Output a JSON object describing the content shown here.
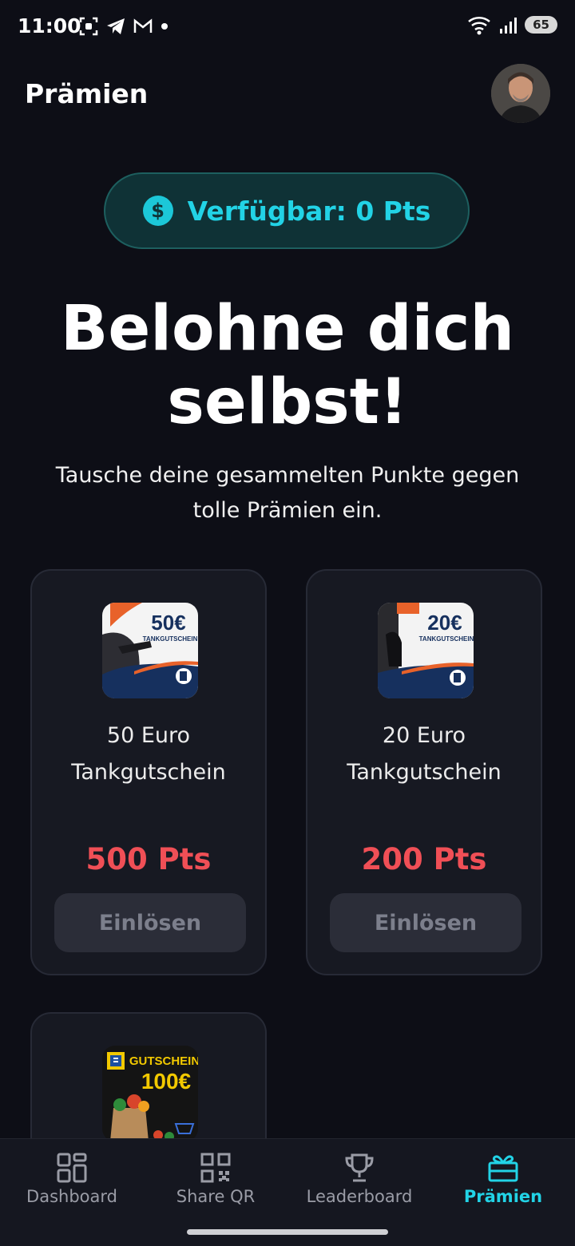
{
  "status": {
    "time": "11:00",
    "battery": "65"
  },
  "header": {
    "title": "Prämien"
  },
  "points": {
    "label": "Verfügbar: 0 Pts"
  },
  "hero": {
    "headline_line1": "Belohne dich",
    "headline_line2": "selbst!",
    "subline": "Tausche deine gesammelten Punkte gegen tolle Prämien ein."
  },
  "rewards": [
    {
      "title": "50 Euro Tankgutschein",
      "price": "500 Pts",
      "button": "Einlösen",
      "image_amount": "50€",
      "image_caption": "TANKGUTSCHEIN"
    },
    {
      "title": "20 Euro Tankgutschein",
      "price": "200 Pts",
      "button": "Einlösen",
      "image_amount": "20€",
      "image_caption": "TANKGUTSCHEIN"
    },
    {
      "image_caption": "GUTSCHEIN",
      "image_amount": "100€"
    }
  ],
  "nav": [
    {
      "label": "Dashboard",
      "icon": "dashboard-grid-icon"
    },
    {
      "label": "Share QR",
      "icon": "qr-code-icon"
    },
    {
      "label": "Leaderboard",
      "icon": "trophy-icon"
    },
    {
      "label": "Prämien",
      "icon": "gift-icon",
      "active": true
    }
  ],
  "colors": {
    "background": "#0d0e16",
    "accent": "#22d3e6",
    "price": "#f04f56"
  }
}
